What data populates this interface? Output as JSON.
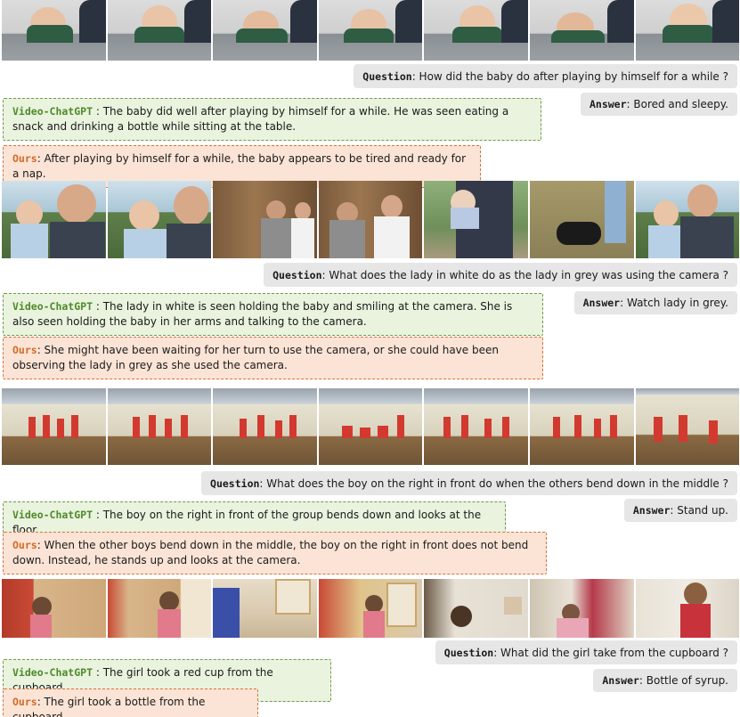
{
  "colors": {
    "video_chatgpt": "#4e8a2a",
    "ours": "#d26a26",
    "gray_bubble": "#e6e6e6",
    "green_bg": "#e9f3de",
    "orange_bg": "#fbe4d6"
  },
  "examples": [
    {
      "question_label": "Question",
      "question": ": How did the baby do after playing by himself for a while ?",
      "answer_label": "Answer",
      "answer": ": Bored and sleepy.",
      "videochatgpt_label": "Video-ChatGPT",
      "videochatgpt": " : The baby did well after playing by himself for a while. He was seen eating a snack and drinking a bottle while sitting at the table.",
      "ours_label": "Ours",
      "ours": ": After playing by himself for a while, the baby appears to be tired and ready for a nap."
    },
    {
      "question_label": "Question",
      "question": ": What does the lady in white do as the lady in grey was using the camera ?",
      "answer_label": "Answer",
      "answer": ": Watch lady in grey.",
      "videochatgpt_label": "Video-ChatGPT",
      "videochatgpt": " : The lady in white is seen holding the baby and smiling at the camera. She is also seen holding the baby in her arms and talking to the camera.",
      "ours_label": "Ours",
      "ours": ": She might have been waiting for her turn to use the camera, or she could have been observing the lady in grey as she used the camera."
    },
    {
      "question_label": "Question",
      "question": ": What does the boy on the right in front do when the others bend down in the middle ?",
      "answer_label": "Answer",
      "answer": ": Stand up.",
      "videochatgpt_label": "Video-ChatGPT",
      "videochatgpt": " : The boy on the right in front of the group bends down and looks at the floor.",
      "ours_label": "Ours",
      "ours": ": When the other boys bend down in the middle, the boy on the right in front does not bend down. Instead, he stands up and looks at the camera."
    },
    {
      "question_label": "Question",
      "question": ": What did the girl take from the cupboard ?",
      "answer_label": "Answer",
      "answer": ": Bottle of syrup.",
      "videochatgpt_label": "Video-ChatGPT",
      "videochatgpt": " : The girl took a red cup from the cupboard.",
      "ours_label": "Ours",
      "ours": ": The girl took a bottle from the cupboard."
    }
  ]
}
